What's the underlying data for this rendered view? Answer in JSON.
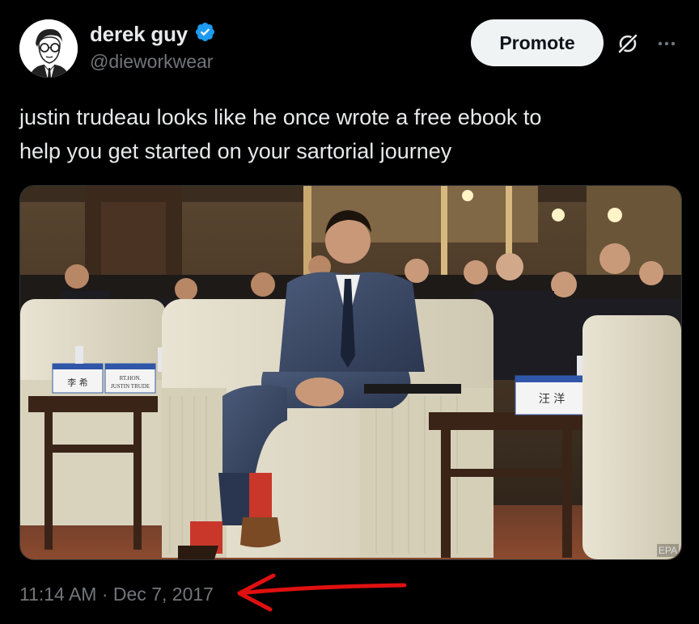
{
  "author": {
    "display_name": "derek guy",
    "handle": "@dieworkwear",
    "verified": true
  },
  "actions": {
    "promote_label": "Promote",
    "grok_icon": "grok-slash-icon",
    "more_icon": "ellipsis-icon"
  },
  "tweet": {
    "text_line1": "justin trudeau looks like he once wrote a free ebook to",
    "text_line2": "help you get started on your sartorial journey"
  },
  "media": {
    "place_cards": {
      "left_name": "李 希",
      "middle_name_line1": "RT.HON.",
      "middle_name_line2": "JUSTIN TRUDE",
      "right_name": "汪 洋"
    },
    "watermark": "EPA"
  },
  "meta": {
    "timestamp": "11:14 AM · Dec 7, 2017"
  },
  "colors": {
    "background": "#000000",
    "text_primary": "#e7e9ea",
    "text_secondary": "#71767b",
    "verified_blue": "#1d9bf0",
    "promote_bg": "#eff3f4",
    "annotation_arrow": "#e01010"
  }
}
